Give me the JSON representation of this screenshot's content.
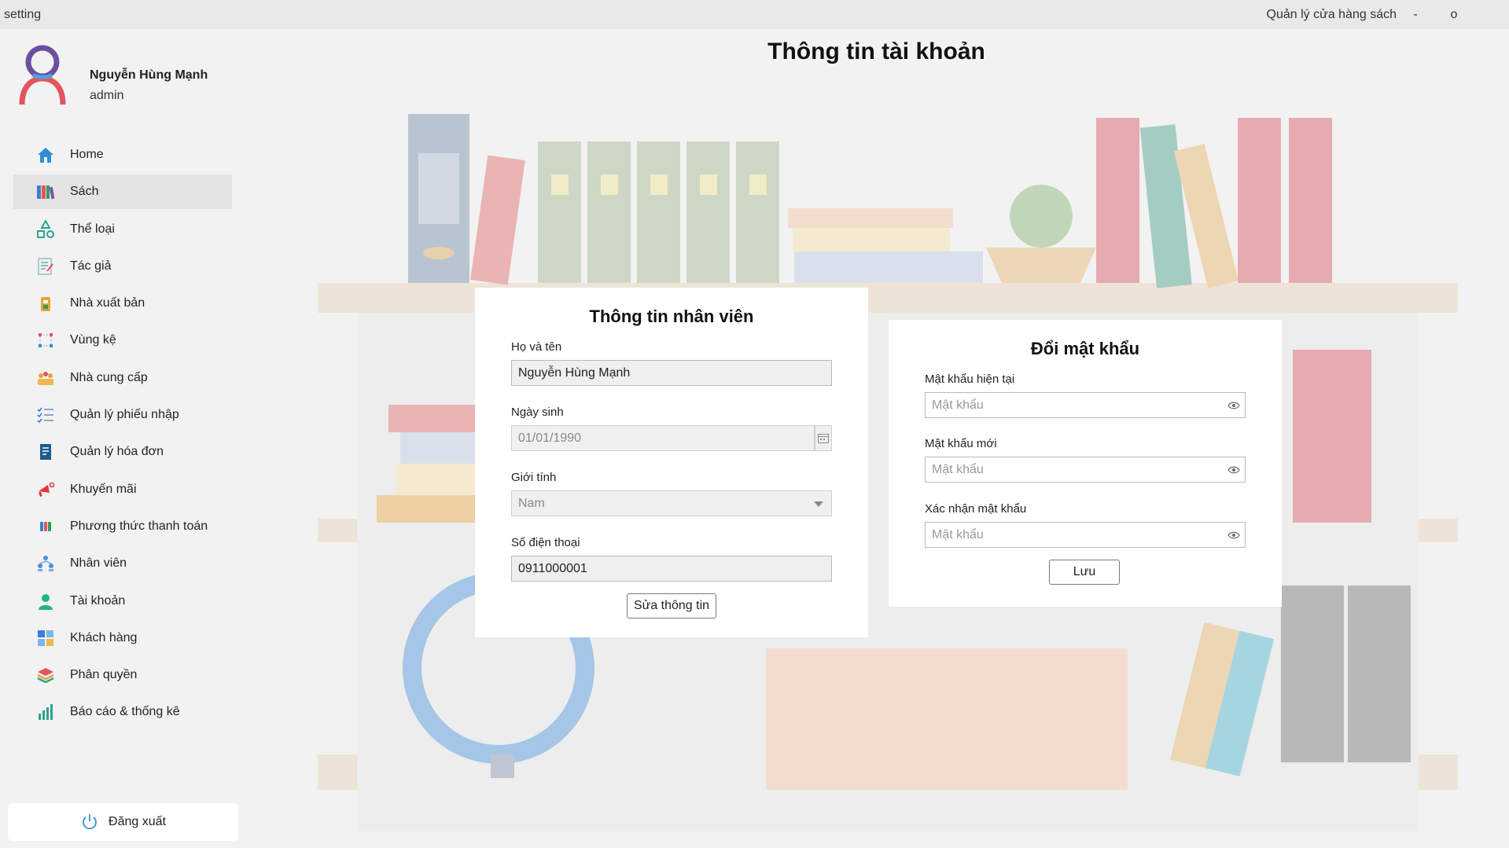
{
  "titlebar": {
    "app_title": "setting",
    "right_title": "Quản lý cửa hàng sách",
    "minimize": "-",
    "maximize": "o"
  },
  "profile": {
    "name": "Nguyễn Hùng Mạnh",
    "role": "admin"
  },
  "sidebar": {
    "items": [
      {
        "label": "Home",
        "icon": "home-icon"
      },
      {
        "label": "Sách",
        "icon": "books-icon",
        "active": true
      },
      {
        "label": "Thể loại",
        "icon": "shapes-icon"
      },
      {
        "label": "Tác giả",
        "icon": "author-icon"
      },
      {
        "label": "Nhà xuất bản",
        "icon": "publisher-icon"
      },
      {
        "label": "Vùng kệ",
        "icon": "shelf-area-icon"
      },
      {
        "label": "Nhà cung cấp",
        "icon": "supplier-icon"
      },
      {
        "label": "Quản lý phiếu nhập",
        "icon": "checklist-icon"
      },
      {
        "label": "Quản lý hóa đơn",
        "icon": "invoice-icon"
      },
      {
        "label": "Khuyến mãi",
        "icon": "megaphone-icon"
      },
      {
        "label": "Phương thức thanh toán",
        "icon": "payment-icon"
      },
      {
        "label": "Nhân viên",
        "icon": "staff-icon"
      },
      {
        "label": "Tài khoản",
        "icon": "account-icon"
      },
      {
        "label": "Khách hàng",
        "icon": "customer-icon"
      },
      {
        "label": "Phân quyền",
        "icon": "layers-icon"
      },
      {
        "label": "Báo cáo & thống kê",
        "icon": "chart-icon"
      }
    ],
    "logout_label": "Đăng xuất"
  },
  "main": {
    "title": "Thông tin tài khoản"
  },
  "employee_card": {
    "title": "Thông tin nhân viên",
    "fullname_label": "Họ và tên",
    "fullname_value": "Nguyễn Hùng Mạnh",
    "dob_label": "Ngày sinh",
    "dob_value": "01/01/1990",
    "gender_label": "Giới tính",
    "gender_value": "Nam",
    "phone_label": "Số điện thoại",
    "phone_value": "0911000001",
    "edit_button": "Sửa thông tin"
  },
  "password_card": {
    "title": "Đổi mật khẩu",
    "current_label": "Mật khẩu hiện tại",
    "current_placeholder": "Mật khẩu",
    "new_label": "Mật khẩu mới",
    "new_placeholder": "Mật khẩu",
    "confirm_label": "Xác nhận mật khẩu",
    "confirm_placeholder": "Mật khẩu",
    "save_button": "Lưu"
  },
  "colors": {
    "accent_blue": "#2f8fd8",
    "avatar_purple": "#6b4fa0",
    "avatar_red": "#e4545b"
  }
}
